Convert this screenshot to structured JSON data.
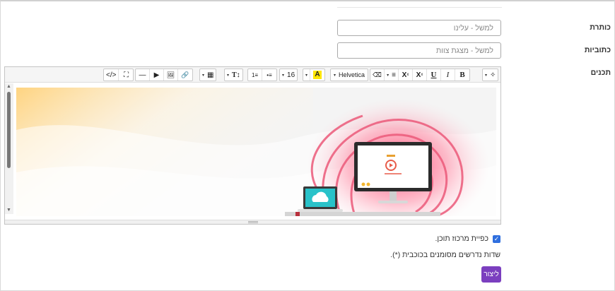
{
  "form": {
    "title_label": "כותרת",
    "title_placeholder": "למשל - עלינו",
    "subtitle_label": "כתוביות",
    "subtitle_placeholder": "למשל - מצגת צוות",
    "content_label": "תכנים"
  },
  "toolbar": {
    "code_view": "</>",
    "fullscreen": "⛶",
    "hr": "—",
    "video": "▶",
    "image": "🖼",
    "link": "🔗",
    "table_caret": "▾",
    "table": "▦",
    "paragraph_caret": "▾",
    "text_height": "T↕",
    "ordered_list": "1≡",
    "unordered_list": "•≡",
    "fontsize_value": "16",
    "fontsize_caret": "▾",
    "color_caret": "▾",
    "color_letter": "A",
    "font_name": "Helvetica",
    "font_caret": "▾",
    "eraser": "⌫",
    "align_caret": "▾",
    "align": "≡",
    "subscript": "X",
    "superscript": "X",
    "underline": "U",
    "italic": "I",
    "bold": "B",
    "magic_caret": "▾",
    "magic": "✧"
  },
  "checkbox": {
    "label": "כפיית מרכוז תוכן.",
    "checked": true
  },
  "required_note": "שדות נדרשים מסומנים בכוכבית (*).",
  "submit_label": "ליצור",
  "colors": {
    "accent": "#7b3fbf",
    "checkbox": "#2f6fde",
    "hero_pink": "#f07894",
    "hero_yellow": "#ffd27a"
  }
}
